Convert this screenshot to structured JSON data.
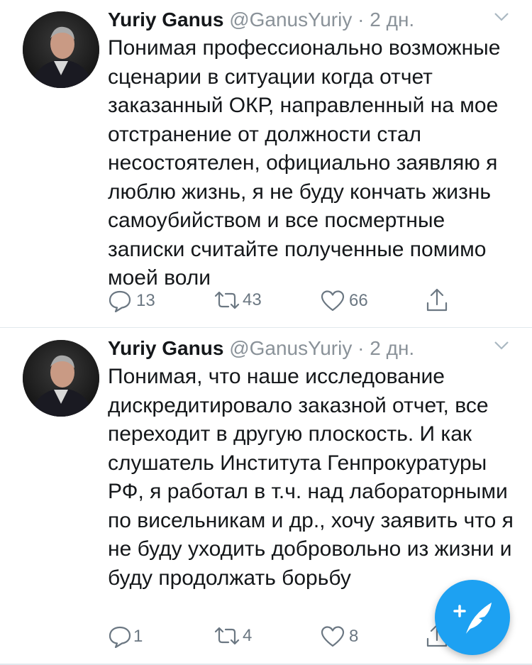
{
  "tweets": [
    {
      "author_name": "Yuriy Ganus",
      "handle": "@GanusYuriy",
      "separator": "·",
      "time": "2 дн.",
      "text": "Понимая профессионально возможные сценарии в ситуации когда отчет заказанный ОКР, направленный на мое отстранение от должности стал несостоятелен, официально заявляю я люблю жизнь, я не буду кончать жизнь самоубийством и все посмертные записки считайте полученные помимо моей воли",
      "replies": "13",
      "retweets": "43",
      "likes": "66"
    },
    {
      "author_name": "Yuriy Ganus",
      "handle": "@GanusYuriy",
      "separator": "·",
      "time": "2 дн.",
      "text": "Понимая, что наше исследование дискредитировало заказной отчет, все переходит в другую плоскость. И как слушатель Института Генпрокуратуры РФ, я работал в т.ч. над лабораторными по висельникам и др., хочу заявить что я не буду уходить добровольно из жизни и буду продолжать борьбу",
      "replies": "1",
      "retweets": "4",
      "likes": "8"
    }
  ],
  "colors": {
    "accent": "#1da1f2",
    "secondary_text": "#8a9299",
    "icon_gray": "#6b7782",
    "divider": "#e1e8ed"
  },
  "icons": [
    "reply-icon",
    "retweet-icon",
    "like-icon",
    "share-icon",
    "chevron-down-icon",
    "compose-tweet-icon"
  ]
}
